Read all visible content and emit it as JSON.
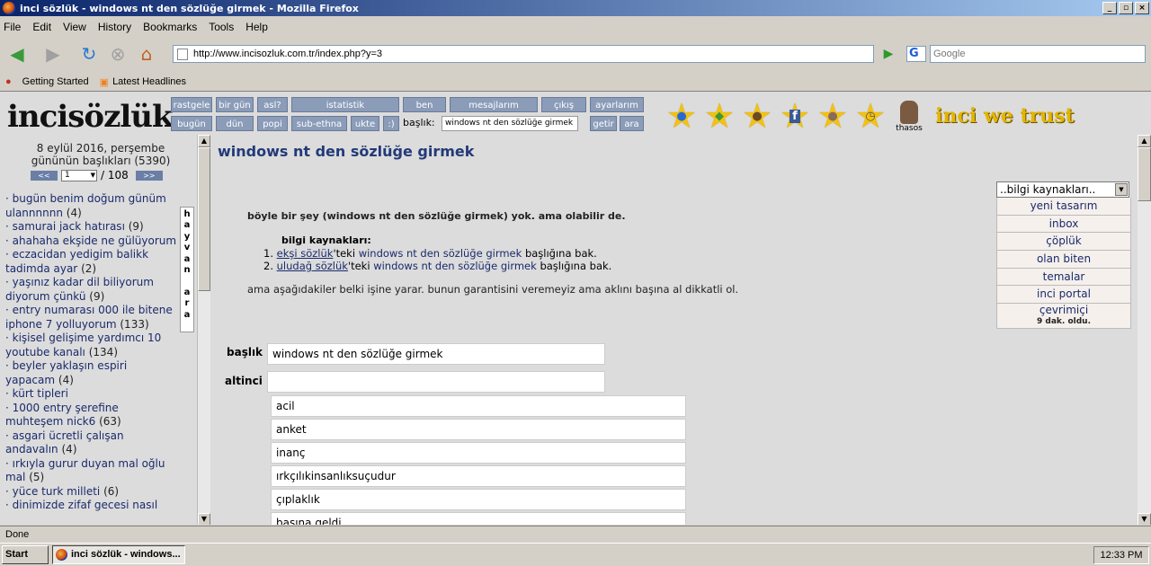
{
  "window": {
    "title": "inci sözlük - windows nt den sözlüğe girmek - Mozilla Firefox"
  },
  "menu": [
    "File",
    "Edit",
    "View",
    "History",
    "Bookmarks",
    "Tools",
    "Help"
  ],
  "nav": {
    "url": "http://www.incisozluk.com.tr/index.php?y=3",
    "search_placeholder": "Google"
  },
  "bookmarks": [
    "Getting Started",
    "Latest Headlines"
  ],
  "site": {
    "logo": "incisözlük",
    "top_buttons": [
      "rastgele",
      "bir gün",
      "asl?",
      "istatistik",
      "ben",
      "mesajlarım",
      "çıkış",
      "ayarlarım"
    ],
    "bottom_buttons": [
      "bugün",
      "dün",
      "popi",
      "sub-ethna",
      "ukte",
      ":)"
    ],
    "search_label": "başlık:",
    "search_value": "windows nt den sözlüğe girmek",
    "getir": "getir",
    "ara": "ara",
    "trust": "inci we trust",
    "thasos": "thasos"
  },
  "left": {
    "date": "8 eylül 2016, perşembe",
    "count": "gününün başlıkları (5390)",
    "page": "1",
    "total": "/ 108",
    "prev": "<<",
    "next": ">>",
    "hayvan": "hayvan ara",
    "items": [
      {
        "t": "bugün benim doğum günüm ulannnnnn",
        "c": "(4)"
      },
      {
        "t": "samurai jack hatırası",
        "c": "(9)"
      },
      {
        "t": "ahahaha ekşide ne gülüyorum",
        "c": ""
      },
      {
        "t": "eczacidan yedigim balikk tadimda ayar",
        "c": "(2)"
      },
      {
        "t": "yaşınız kadar dil biliyorum diyorum çünkü",
        "c": "(9)"
      },
      {
        "t": "entry numarası 000 ile bitene iphone 7 yolluyorum",
        "c": "(133)"
      },
      {
        "t": "kişisel gelişime yardımcı 10 youtube kanalı",
        "c": "(134)"
      },
      {
        "t": "beyler yaklaşın espiri yapacam",
        "c": "(4)"
      },
      {
        "t": "kürt tipleri",
        "c": ""
      },
      {
        "t": "1000 entry şerefine muhteşem nick6",
        "c": "(63)"
      },
      {
        "t": "asgari ücretli çalışan andavalın",
        "c": "(4)"
      },
      {
        "t": "ırkıyla gurur duyan mal oğlu mal",
        "c": "(5)"
      },
      {
        "t": "yüce turk milleti",
        "c": "(6)"
      },
      {
        "t": "dinimizde zifaf gecesi nasıl",
        "c": ""
      }
    ]
  },
  "main": {
    "title": "windows nt den sözlüğe girmek",
    "notfound": "böyle bir şey (windows nt den sözlüğe girmek) yok. ama olabilir de.",
    "bilgi_label": "bilgi kaynakları:",
    "sources": [
      {
        "num": "1.",
        "site": "ekşi sözlük",
        "pre": "'teki ",
        "link": "windows nt den sözlüğe girmek",
        "post": " başlığına bak."
      },
      {
        "num": "2.",
        "site": "uludağ sözlük",
        "pre": "'teki ",
        "link": "windows nt den sözlüğe girmek",
        "post": " başlığına bak."
      }
    ],
    "hint": "ama aşağıdakiler belki işine yarar. bunun garantisini veremeyiz ama aklını başına al dikkatli ol.",
    "baslik_label": "başlık",
    "baslik_value": "windows nt den sözlüğe girmek",
    "altinci_label": "altinci",
    "options": [
      "acil",
      "anket",
      "inanç",
      "ırkçılıkinsanlıksuçudur",
      "çıplaklık",
      "basına geldi"
    ]
  },
  "right": {
    "select": "..bilgi kaynakları..",
    "items": [
      "yeni tasarım",
      "inbox",
      "çöplük",
      "olan biten",
      "temalar",
      "inci portal"
    ],
    "last": "çevrimiçi",
    "last_sub": "9 dak. oldu."
  },
  "status": "Done",
  "taskbar": {
    "start": "Start",
    "item": "inci sözlük - windows...",
    "clock": "12:33 PM"
  }
}
